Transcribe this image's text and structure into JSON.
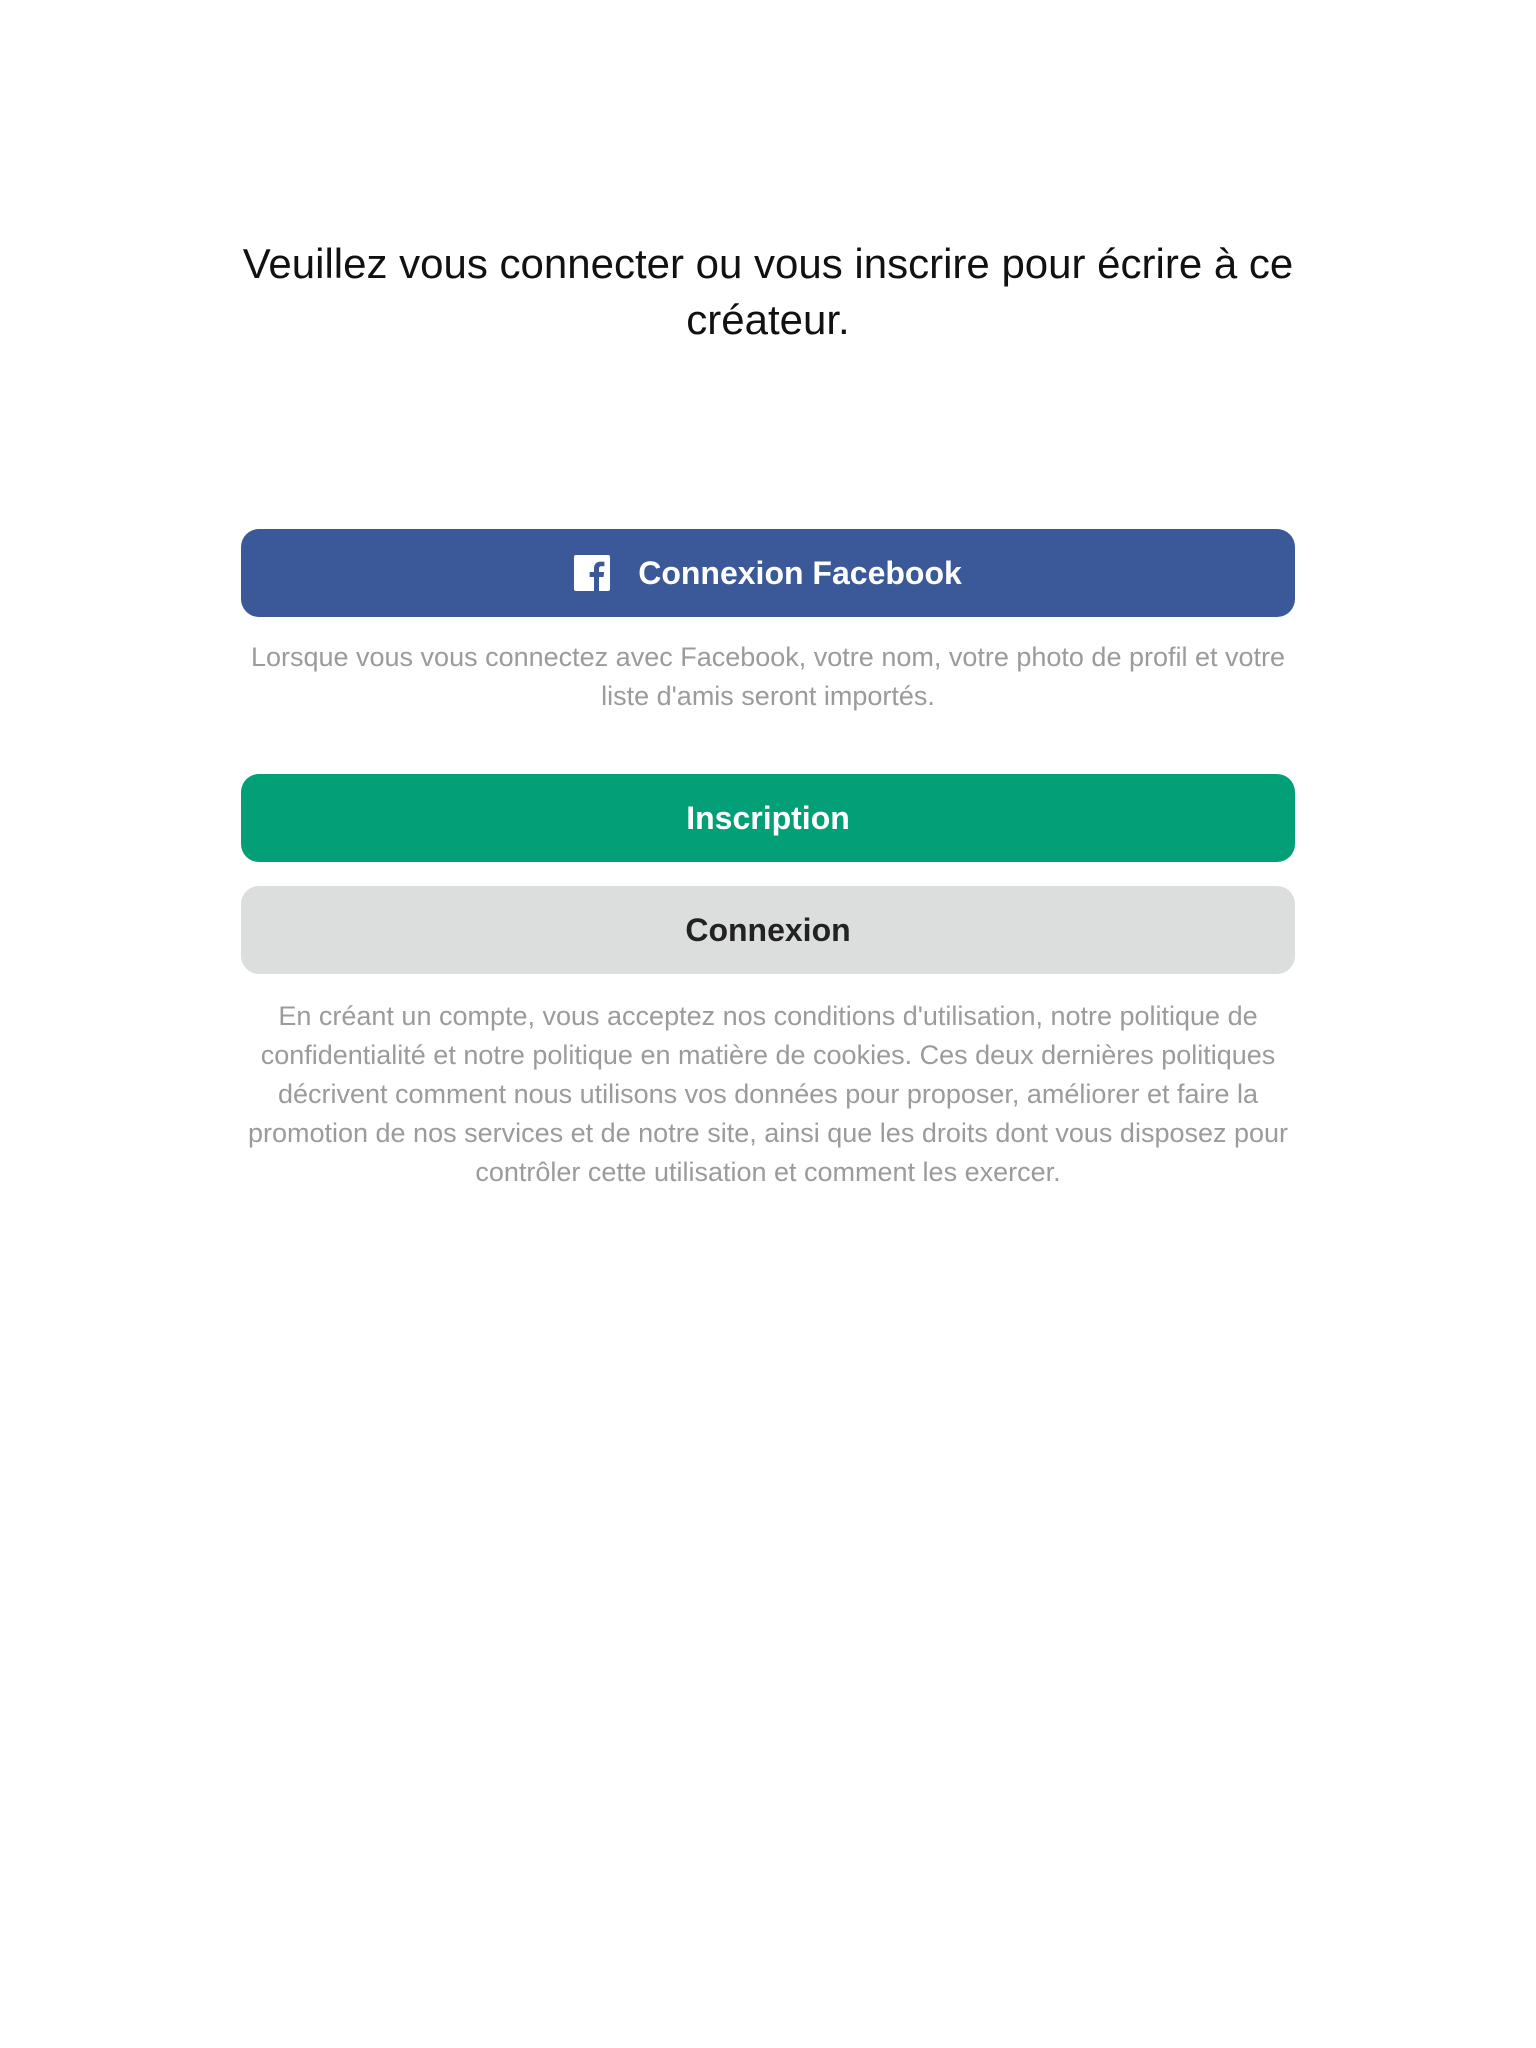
{
  "prompt": {
    "title": "Veuillez vous connecter ou vous inscrire pour écrire à ce créateur."
  },
  "facebook": {
    "button_label": "Connexion Facebook",
    "icon": "facebook-icon",
    "note": "Lorsque vous vous connectez avec Facebook, votre nom, votre photo de profil et votre liste d'amis seront importés.",
    "color": "#3b5998"
  },
  "signup": {
    "button_label": "Inscription",
    "color": "#03a077"
  },
  "login": {
    "button_label": "Connexion",
    "color": "#dcdedd"
  },
  "terms": {
    "text": "En créant un compte, vous acceptez nos conditions d'utilisation, notre politique de confidentialité et notre politique en matière de cookies. Ces deux dernières politiques décrivent comment nous utilisons vos données pour proposer, améliorer et faire la promotion de nos services et de notre site, ainsi que les droits dont vous disposez pour contrôler cette utilisation et comment les exercer."
  }
}
